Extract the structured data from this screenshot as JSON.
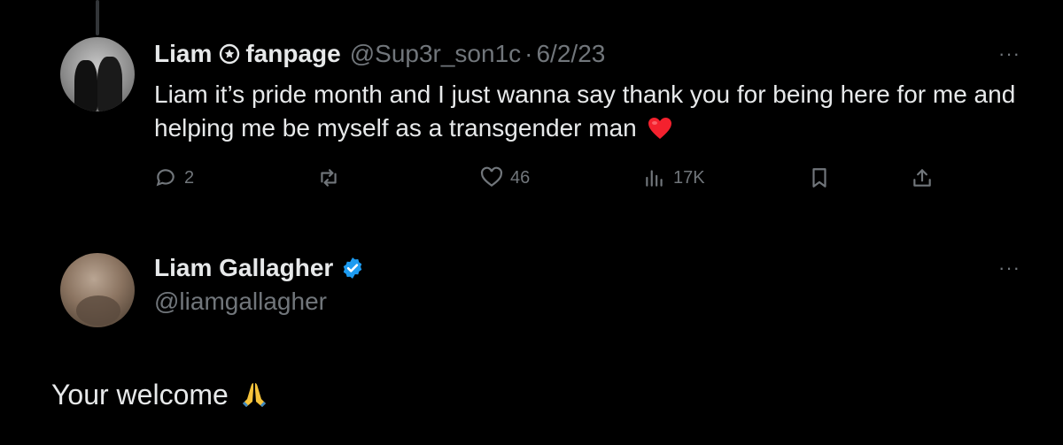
{
  "tweet": {
    "author_name": "Liam",
    "author_name_suffix": "fanpage",
    "handle": "@Sup3r_son1c",
    "separator": "·",
    "date": "6/2/23",
    "more_label": "···",
    "text": "Liam it’s pride month and I just wanna say thank you for being here for me and helping me be myself as a transgender man",
    "actions": {
      "replies": "2",
      "retweets": "",
      "likes": "46",
      "views": "17K"
    }
  },
  "reply": {
    "author_name": "Liam Gallagher",
    "handle": "@liamgallagher",
    "more_label": "···",
    "text": "Your welcome"
  },
  "colors": {
    "background": "#000000",
    "primary_text": "#e7e9ea",
    "muted_text": "#71767b",
    "verified": "#1d9bf0",
    "heart": "#f4212e"
  },
  "icons": [
    "star-badge-icon",
    "heart-emoji-icon",
    "reply-icon",
    "retweet-icon",
    "like-icon",
    "views-icon",
    "bookmark-icon",
    "share-icon",
    "verified-icon",
    "pray-emoji-icon"
  ]
}
